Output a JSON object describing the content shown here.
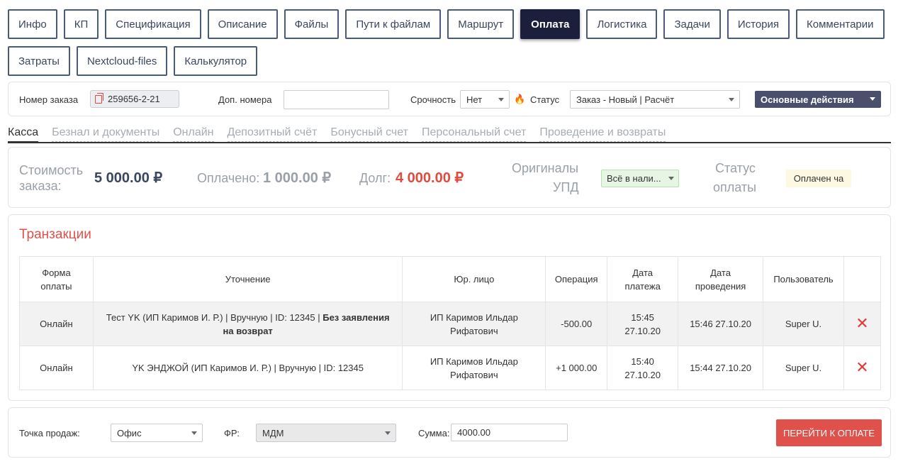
{
  "tabs_row1": [
    "Инфо",
    "КП",
    "Спецификация",
    "Описание",
    "Файлы",
    "Пути к файлам",
    "Маршрут",
    "Оплата",
    "Логистика",
    "Задачи",
    "История",
    "Комментарии"
  ],
  "tabs_row2": [
    "Затраты",
    "Nextcloud-files",
    "Калькулятор"
  ],
  "active_tab": "Оплата",
  "order": {
    "number_label": "Номер заказа",
    "number_value": "259656-2-21",
    "extra_label": "Доп. номера",
    "extra_value": "",
    "urgency_label": "Срочность",
    "urgency_value": "Нет",
    "status_label": "Статус",
    "status_value": "Заказ - Новый | Расчёт",
    "actions_label": "Основные действия"
  },
  "subtabs": [
    "Касса",
    "Безнал и документы",
    "Онлайн",
    "Депозитный счёт",
    "Бонусный счет",
    "Персональный счет",
    "Проведение и возвраты"
  ],
  "summary": {
    "cost_label_1": "Стоимость",
    "cost_label_2": "заказа:",
    "cost_value": "5 000.00 ₽",
    "paid_label": "Оплачено:",
    "paid_value": "1 000.00 ₽",
    "debt_label": "Долг:",
    "debt_value": "4 000.00 ₽",
    "upd_label_1": "Оригиналы",
    "upd_label_2": "УПД",
    "upd_value": "Всё в нали...",
    "pay_status_label_1": "Статус",
    "pay_status_label_2": "оплаты",
    "pay_status_value": "Оплачен ча",
    "colors": {
      "cost": "#3a4660",
      "paid": "#9aa0a8",
      "debt": "#e04a3f"
    }
  },
  "transactions": {
    "title": "Транзакции",
    "headers": [
      [
        "Форма",
        "оплаты"
      ],
      [
        "Уточнение"
      ],
      [
        "Юр. лицо"
      ],
      [
        "Операция"
      ],
      [
        "Дата",
        "платежа"
      ],
      [
        "Дата",
        "проведения"
      ],
      [
        "Пользователь"
      ],
      [
        ""
      ]
    ],
    "rows": [
      {
        "form": "Онлайн",
        "note": "Тест YK (ИП Каримов И. Р.) | Вручную | ID: 12345 | ",
        "note_bold": "Без заявления на возврат",
        "entity_1": "ИП Каримов Ильдар",
        "entity_2": "Рифатович",
        "operation": "-500.00",
        "pay_time": "15:45",
        "pay_date": "27.10.20",
        "posted": "15:46 27.10.20",
        "user": "Super U."
      },
      {
        "form": "Онлайн",
        "note": "YK ЭНДЖОЙ (ИП Каримов И. Р.) | Вручную | ID: 12345",
        "note_bold": "",
        "entity_1": "ИП Каримов Ильдар",
        "entity_2": "Рифатович",
        "operation": "+1 000.00",
        "pay_time": "15:40",
        "pay_date": "27.10.20",
        "posted": "15:44 27.10.20",
        "user": "Super U."
      }
    ],
    "delete_glyph": "✕"
  },
  "payment": {
    "point_label": "Точка продаж:",
    "point_value": "Офис",
    "fr_label": "ФР:",
    "fr_value": "МДМ",
    "sum_label": "Сумма:",
    "sum_value": "4000.00",
    "button_label": "ПЕРЕЙТИ К ОПЛАТЕ"
  }
}
